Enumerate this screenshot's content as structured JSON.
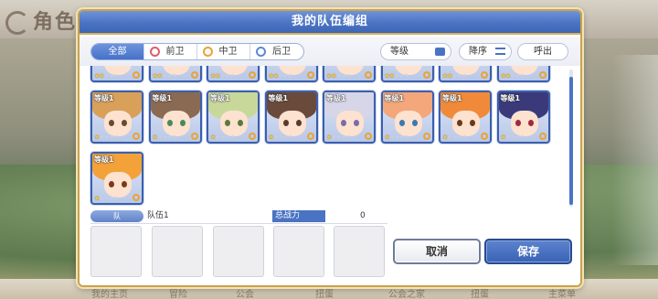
{
  "background": {
    "title": "角色一",
    "bottom_nav": [
      "我的主页",
      "冒险",
      "公会",
      "扭蛋",
      "公会之家",
      "扭蛋",
      "主菜单"
    ]
  },
  "dialog": {
    "title": "我的队伍编组",
    "filters": {
      "tabs": [
        {
          "label": "全部",
          "active": true
        },
        {
          "label": "前卫",
          "icon": "front-position-icon"
        },
        {
          "label": "中卫",
          "icon": "middle-position-icon"
        },
        {
          "label": "后卫",
          "icon": "back-position-icon"
        }
      ],
      "sort_key": "等级",
      "sort_order": "降序",
      "call_label": "呼出"
    },
    "characters": [
      {
        "level": "",
        "stars": 2,
        "hair": "#c9b4e6",
        "eye": "#6a4aa0"
      },
      {
        "level": "",
        "stars": 2,
        "hair": "#e9c4a2",
        "eye": "#7a4a2a"
      },
      {
        "level": "",
        "stars": 2,
        "hair": "#e7b08a",
        "eye": "#7a4a2a"
      },
      {
        "level": "",
        "stars": 2,
        "hair": "#b08a70",
        "eye": "#5a3a2a"
      },
      {
        "level": "",
        "stars": 2,
        "hair": "#f1c6cf",
        "eye": "#a04a6a"
      },
      {
        "level": "",
        "stars": 2,
        "hair": "#e6c27a",
        "eye": "#6a5a2a"
      },
      {
        "level": "",
        "stars": 2,
        "hair": "#f0d7d7",
        "eye": "#8a4a5a"
      },
      {
        "level": "等级1",
        "stars": 2,
        "hair": "#cfd3e2",
        "eye": "#5a6ab0"
      },
      {
        "level": "等级1",
        "stars": 1,
        "hair": "#d9a05a",
        "eye": "#6a4a2a"
      },
      {
        "level": "等级1",
        "stars": 1,
        "hair": "#8a6a52",
        "eye": "#4a8a5a"
      },
      {
        "level": "等级1",
        "stars": 1,
        "hair": "#c8d89a",
        "eye": "#5a7a3a"
      },
      {
        "level": "等级1",
        "stars": 1,
        "hair": "#6a4a3a",
        "eye": "#5a3a2a"
      },
      {
        "level": "等级1",
        "stars": 1,
        "hair": "#d6d6e8",
        "eye": "#7a6ab0"
      },
      {
        "level": "等级1",
        "stars": 1,
        "hair": "#f3a77a",
        "eye": "#3a7ab0"
      },
      {
        "level": "等级1",
        "stars": 1,
        "hair": "#f08a3a",
        "eye": "#6a3a1a"
      },
      {
        "level": "等级1",
        "stars": 1,
        "hair": "#3a3a7a",
        "eye": "#a02a3a"
      },
      {
        "level": "等级1",
        "stars": 1,
        "hair": "#f3a23a",
        "eye": "#7a3a1a"
      }
    ],
    "party": {
      "number_label": "队",
      "name": "队伍1",
      "power_label": "总战力",
      "power_value": "0"
    },
    "cancel_label": "取消",
    "save_label": "保存"
  }
}
